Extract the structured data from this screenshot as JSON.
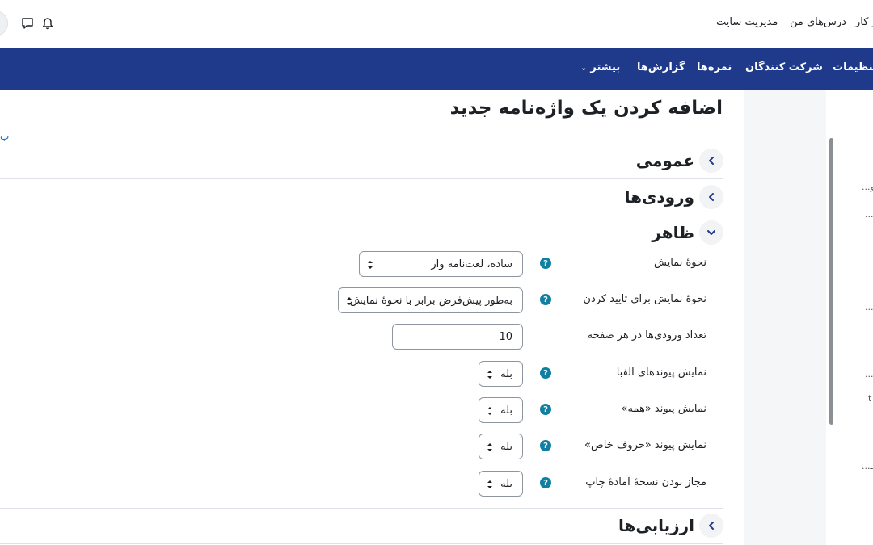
{
  "topbar": {
    "links": [
      "مدیریت سایت",
      "درس‌های من",
      "ر کار"
    ],
    "icons": [
      "bell-icon",
      "chat-icon"
    ]
  },
  "secnav": {
    "items": [
      "تنظیمات",
      "شرکت کنندگان",
      "نمره‌ها",
      "گزارش‌ها",
      "بیشتر"
    ]
  },
  "drawer": {
    "fragments": [
      "...و",
      "...",
      "...",
      "...",
      "t",
      "...ـ"
    ]
  },
  "page": {
    "title": "اضافه کردن یک واژه‌نامه جدید",
    "edge_fragment": "ب"
  },
  "sections": {
    "general": "عمومی",
    "entries": "ورودی‌ها",
    "appearance": "ظاهر",
    "ratings": "ارزیابی‌ها"
  },
  "appearance_form": {
    "display_format": {
      "label": "نحوهٔ نمایش",
      "value": "ساده، لغت‌نامه وار"
    },
    "approval_display_format": {
      "label": "نحوهٔ نمایش برای تایید کردن",
      "value": "به‌طور پیش‌فرض برابر با نحوهٔ نمایش"
    },
    "entries_per_page": {
      "label": "تعداد ورودی‌ها در هر صفحه",
      "value": "10"
    },
    "show_alphabet": {
      "label": "نمایش پیوندهای الفبا",
      "value": "بله"
    },
    "show_all": {
      "label": "نمایش پیوند «همه»",
      "value": "بله"
    },
    "show_special": {
      "label": "نمایش پیوند «حروف خاص»",
      "value": "بله"
    },
    "allow_print": {
      "label": "مجاز بودن نسخهٔ آمادهٔ چاپ",
      "value": "بله"
    }
  },
  "help_glyph": "?",
  "colors": {
    "primary_nav": "#1f3a8a",
    "help": "#0f7fa3",
    "border": "#8f959e"
  }
}
